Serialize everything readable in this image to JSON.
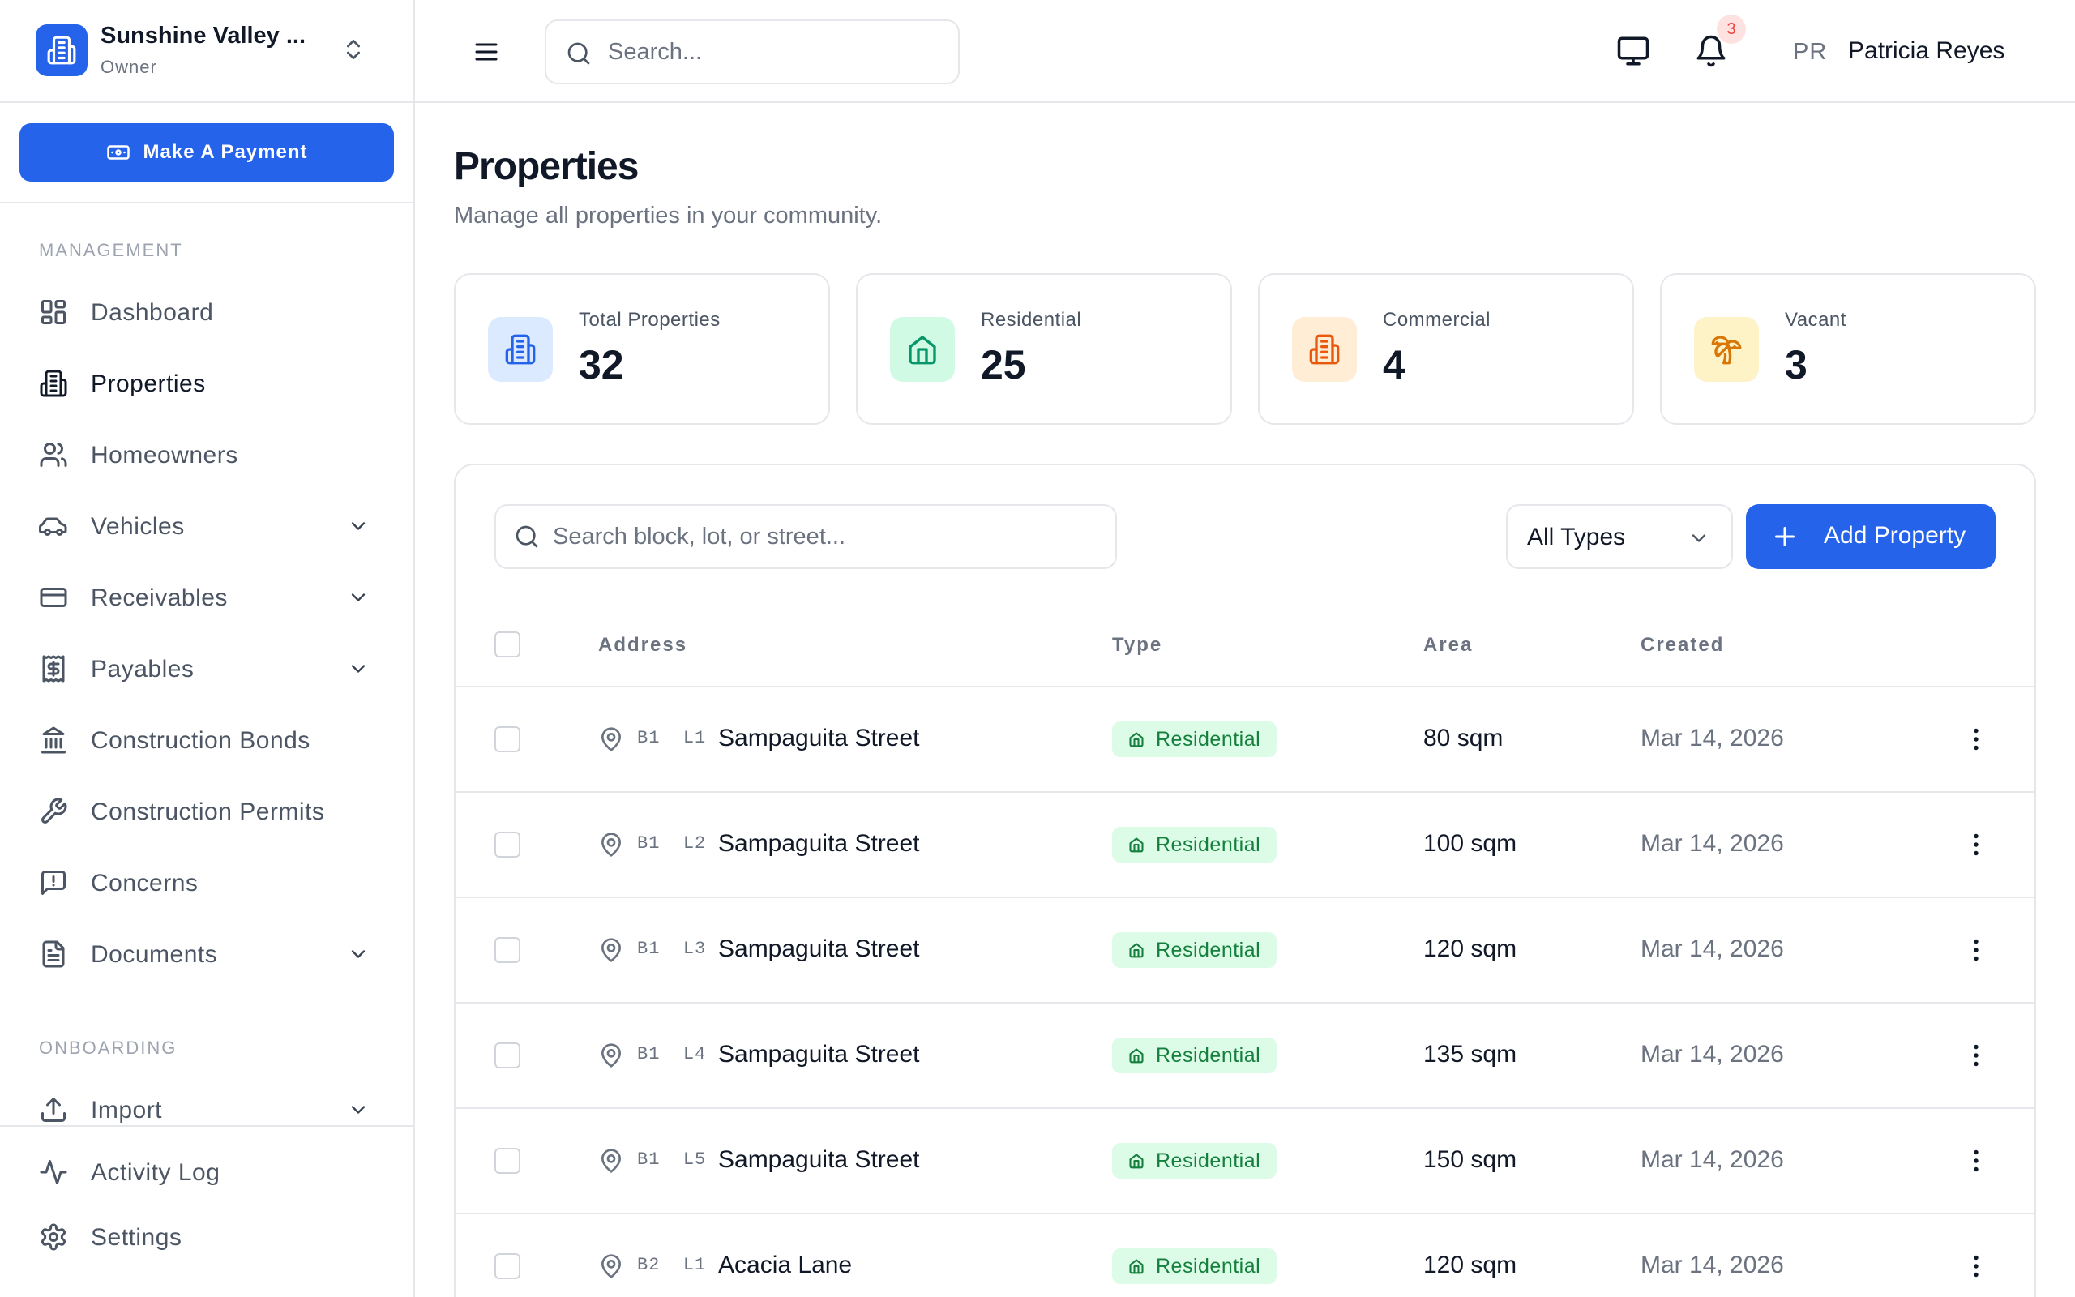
{
  "org": {
    "name": "Sunshine Valley ...",
    "role": "Owner"
  },
  "sidebar": {
    "payment_label": "Make A Payment",
    "section_management": "MANAGEMENT",
    "section_onboarding": "ONBOARDING",
    "items": [
      {
        "label": "Dashboard"
      },
      {
        "label": "Properties"
      },
      {
        "label": "Homeowners"
      },
      {
        "label": "Vehicles"
      },
      {
        "label": "Receivables"
      },
      {
        "label": "Payables"
      },
      {
        "label": "Construction Bonds"
      },
      {
        "label": "Construction Permits"
      },
      {
        "label": "Concerns"
      },
      {
        "label": "Documents"
      },
      {
        "label": "Import"
      },
      {
        "label": "Activity Log"
      },
      {
        "label": "Settings"
      }
    ]
  },
  "header": {
    "search_placeholder": "Search...",
    "notification_count": "3",
    "user_initials": "PR",
    "user_name": "Patricia Reyes"
  },
  "page": {
    "title": "Properties",
    "subtitle": "Manage all properties in your community."
  },
  "stats": [
    {
      "label": "Total Properties",
      "value": "32",
      "icon": "building-icon"
    },
    {
      "label": "Residential",
      "value": "25",
      "icon": "home-icon"
    },
    {
      "label": "Commercial",
      "value": "4",
      "icon": "store-icon"
    },
    {
      "label": "Vacant",
      "value": "3",
      "icon": "palm-tree-icon"
    }
  ],
  "table": {
    "search_placeholder": "Search block, lot, or street...",
    "type_filter": "All Types",
    "add_label": "Add Property",
    "columns": {
      "address": "Address",
      "type": "Type",
      "area": "Area",
      "created": "Created"
    },
    "rows": [
      {
        "block": "B1",
        "lot": "L1",
        "street": "Sampaguita Street",
        "type": "Residential",
        "area": "80 sqm",
        "created": "Mar 14, 2026"
      },
      {
        "block": "B1",
        "lot": "L2",
        "street": "Sampaguita Street",
        "type": "Residential",
        "area": "100 sqm",
        "created": "Mar 14, 2026"
      },
      {
        "block": "B1",
        "lot": "L3",
        "street": "Sampaguita Street",
        "type": "Residential",
        "area": "120 sqm",
        "created": "Mar 14, 2026"
      },
      {
        "block": "B1",
        "lot": "L4",
        "street": "Sampaguita Street",
        "type": "Residential",
        "area": "135 sqm",
        "created": "Mar 14, 2026"
      },
      {
        "block": "B1",
        "lot": "L5",
        "street": "Sampaguita Street",
        "type": "Residential",
        "area": "150 sqm",
        "created": "Mar 14, 2026"
      },
      {
        "block": "B2",
        "lot": "L1",
        "street": "Acacia Lane",
        "type": "Residential",
        "area": "120 sqm",
        "created": "Mar 14, 2026"
      }
    ]
  },
  "colors": {
    "accent": "#2563eb",
    "residential_bg": "#dcfce7",
    "residential_text": "#15803d",
    "stat_total_bg": "#dbeafe",
    "stat_residential_bg": "#d1fae5",
    "stat_commercial_bg": "#ffedd5",
    "stat_vacant_bg": "#fef3c7"
  }
}
